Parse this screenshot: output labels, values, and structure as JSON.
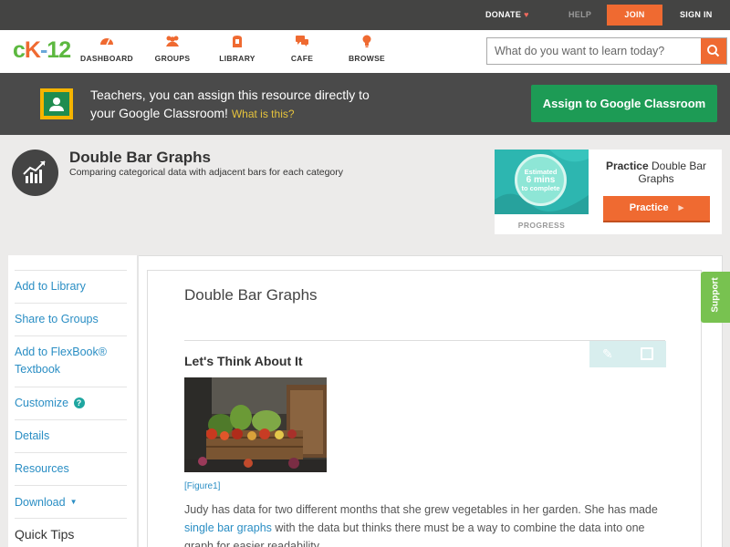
{
  "topbar": {
    "donate": "DONATE",
    "help": "HELP",
    "join": "JOIN",
    "signin": "SIGN IN"
  },
  "logo": {
    "c": "c",
    "k": "K",
    "dash": "-",
    "num": "12"
  },
  "nav": {
    "items": [
      {
        "label": "DASHBOARD",
        "icon": "dashboard-icon"
      },
      {
        "label": "GROUPS",
        "icon": "groups-icon"
      },
      {
        "label": "LIBRARY",
        "icon": "library-icon"
      },
      {
        "label": "CAFE",
        "icon": "cafe-icon"
      },
      {
        "label": "BROWSE",
        "icon": "browse-icon"
      }
    ],
    "search_placeholder": "What do you want to learn today?"
  },
  "banner": {
    "line1": "Teachers, you can assign this resource directly to",
    "line2": "your Google Classroom!",
    "what": "What is this?",
    "assign": "Assign to Google Classroom"
  },
  "header": {
    "title": "Double Bar Graphs",
    "subtitle": "Comparing categorical data with adjacent bars for each category"
  },
  "practice": {
    "circle_top": "Estimated",
    "circle_mid": "6 mins",
    "circle_bot": "to complete",
    "progress": "PROGRESS",
    "title_bold": "Practice",
    "title_rest": "Double Bar Graphs",
    "button": "Practice"
  },
  "sidebar": {
    "items": [
      "Add to Library",
      "Share to Groups",
      "Add to FlexBook®",
      "Textbook",
      "Customize",
      "Details",
      "Resources",
      "Download",
      "Quick Tips"
    ],
    "help_glyph": "?"
  },
  "article": {
    "title": "Double Bar Graphs",
    "section": "Let's Think About It",
    "figure": "[Figure1]",
    "para_a": "Judy has data for two different months that she grew vegetables in her garden. She has made",
    "para_link": "single bar graphs",
    "para_b": "with the data but thinks there must be a way to combine the data into one",
    "para_c": "graph for easier readability."
  },
  "support": "Support",
  "colors": {
    "accent": "#ef6a31",
    "link": "#2a8ec4",
    "google_green": "#1d9b55",
    "support_green": "#78c250"
  }
}
